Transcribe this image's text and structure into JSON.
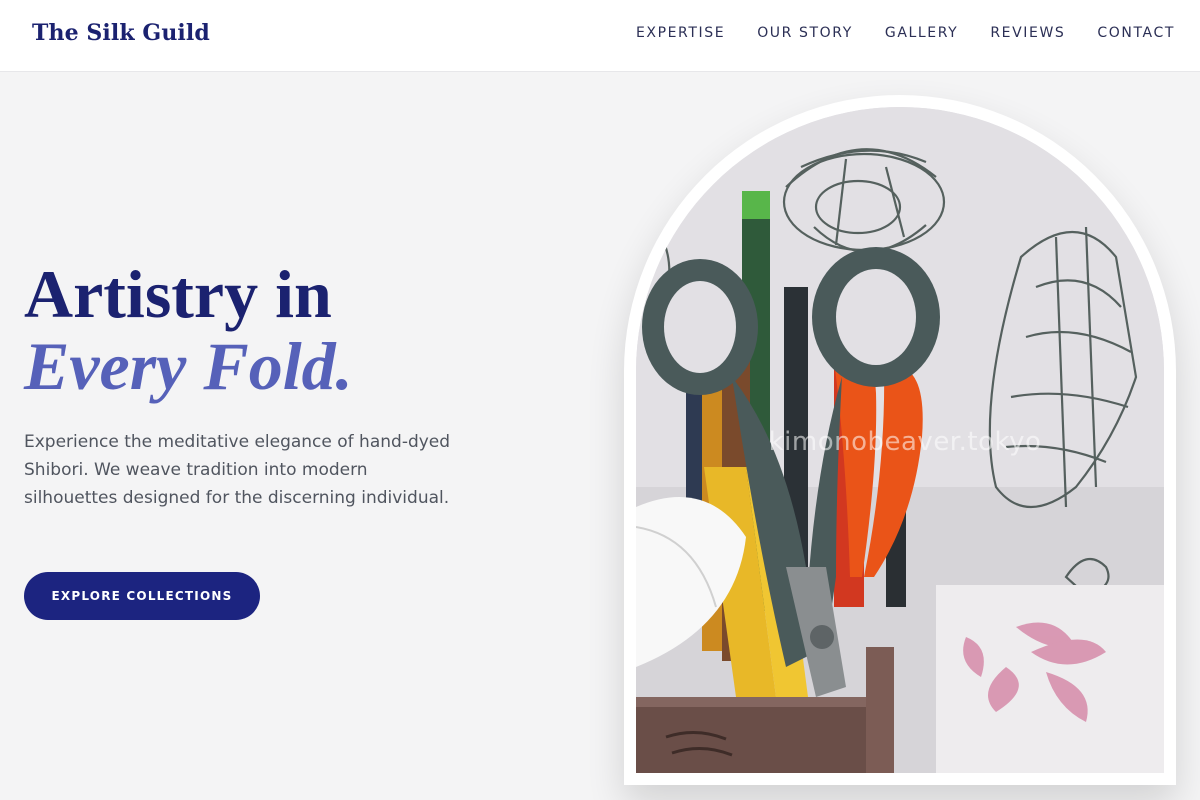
{
  "brand": {
    "name": "The Silk Guild"
  },
  "nav": {
    "items": [
      {
        "label": "EXPERTISE"
      },
      {
        "label": "OUR STORY"
      },
      {
        "label": "GALLERY"
      },
      {
        "label": "REVIEWS"
      },
      {
        "label": "CONTACT"
      }
    ]
  },
  "hero": {
    "headline_line1": "Artistry in",
    "headline_line2": "Every Fold.",
    "description": "Experience the meditative elegance of hand-dyed Shibori. We weave tradition into modern silhouettes designed for the discerning individual.",
    "cta_label": "EXPLORE COLLECTIONS",
    "image_watermark": "kimonobeaver.tokyo"
  },
  "colors": {
    "brand_navy": "#1b2270",
    "accent_periwinkle": "#5661b9",
    "button_navy": "#1c2480",
    "background": "#f4f4f5"
  }
}
